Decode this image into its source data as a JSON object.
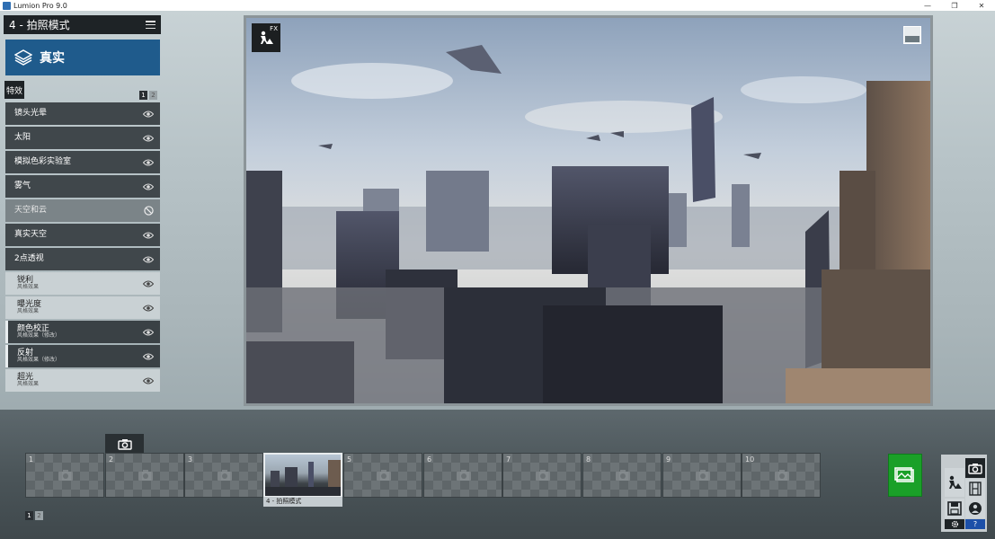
{
  "window": {
    "title": "Lumion Pro 9.0",
    "controls": [
      "—",
      "❐",
      "✕"
    ]
  },
  "left_panel": {
    "mode_title": "4 - 拍照模式",
    "preset_label": "真实",
    "effects_tab_label": "特效",
    "pager": [
      "1",
      "2"
    ],
    "effects": [
      {
        "label": "镜头光晕",
        "sub": "",
        "state": "visible"
      },
      {
        "label": "太阳",
        "sub": "",
        "state": "visible"
      },
      {
        "label": "模拟色彩实验室",
        "sub": "",
        "state": "visible"
      },
      {
        "label": "雾气",
        "sub": "",
        "state": "visible"
      },
      {
        "label": "天空和云",
        "sub": "",
        "state": "disabled"
      },
      {
        "label": "真实天空",
        "sub": "",
        "state": "visible"
      },
      {
        "label": "2点透视",
        "sub": "",
        "state": "visible"
      },
      {
        "label": "锐利",
        "sub": "风格效果",
        "state": "visible"
      },
      {
        "label": "曝光度",
        "sub": "风格效果",
        "state": "visible"
      },
      {
        "label": "颜色校正",
        "sub": "风格效果（修改）",
        "state": "visible"
      },
      {
        "label": "反射",
        "sub": "风格效果（修改）",
        "state": "visible"
      },
      {
        "label": "超光",
        "sub": "风格效果",
        "state": "visible"
      }
    ]
  },
  "viewport": {
    "fx_label": "FX"
  },
  "side_buttons": [
    "FH",
    "FB",
    "U"
  ],
  "bottom": {
    "slots": [
      "1",
      "2",
      "3",
      "",
      "5",
      "6",
      "7",
      "8",
      "9",
      "10"
    ],
    "active_slot_caption": "4 - 拍照模式",
    "pager": [
      "1",
      "2"
    ],
    "help_label": "?"
  },
  "colors": {
    "preset_blue": "#1f5b8c",
    "render_green": "#1aa028",
    "help_blue": "#1c4fa8"
  }
}
